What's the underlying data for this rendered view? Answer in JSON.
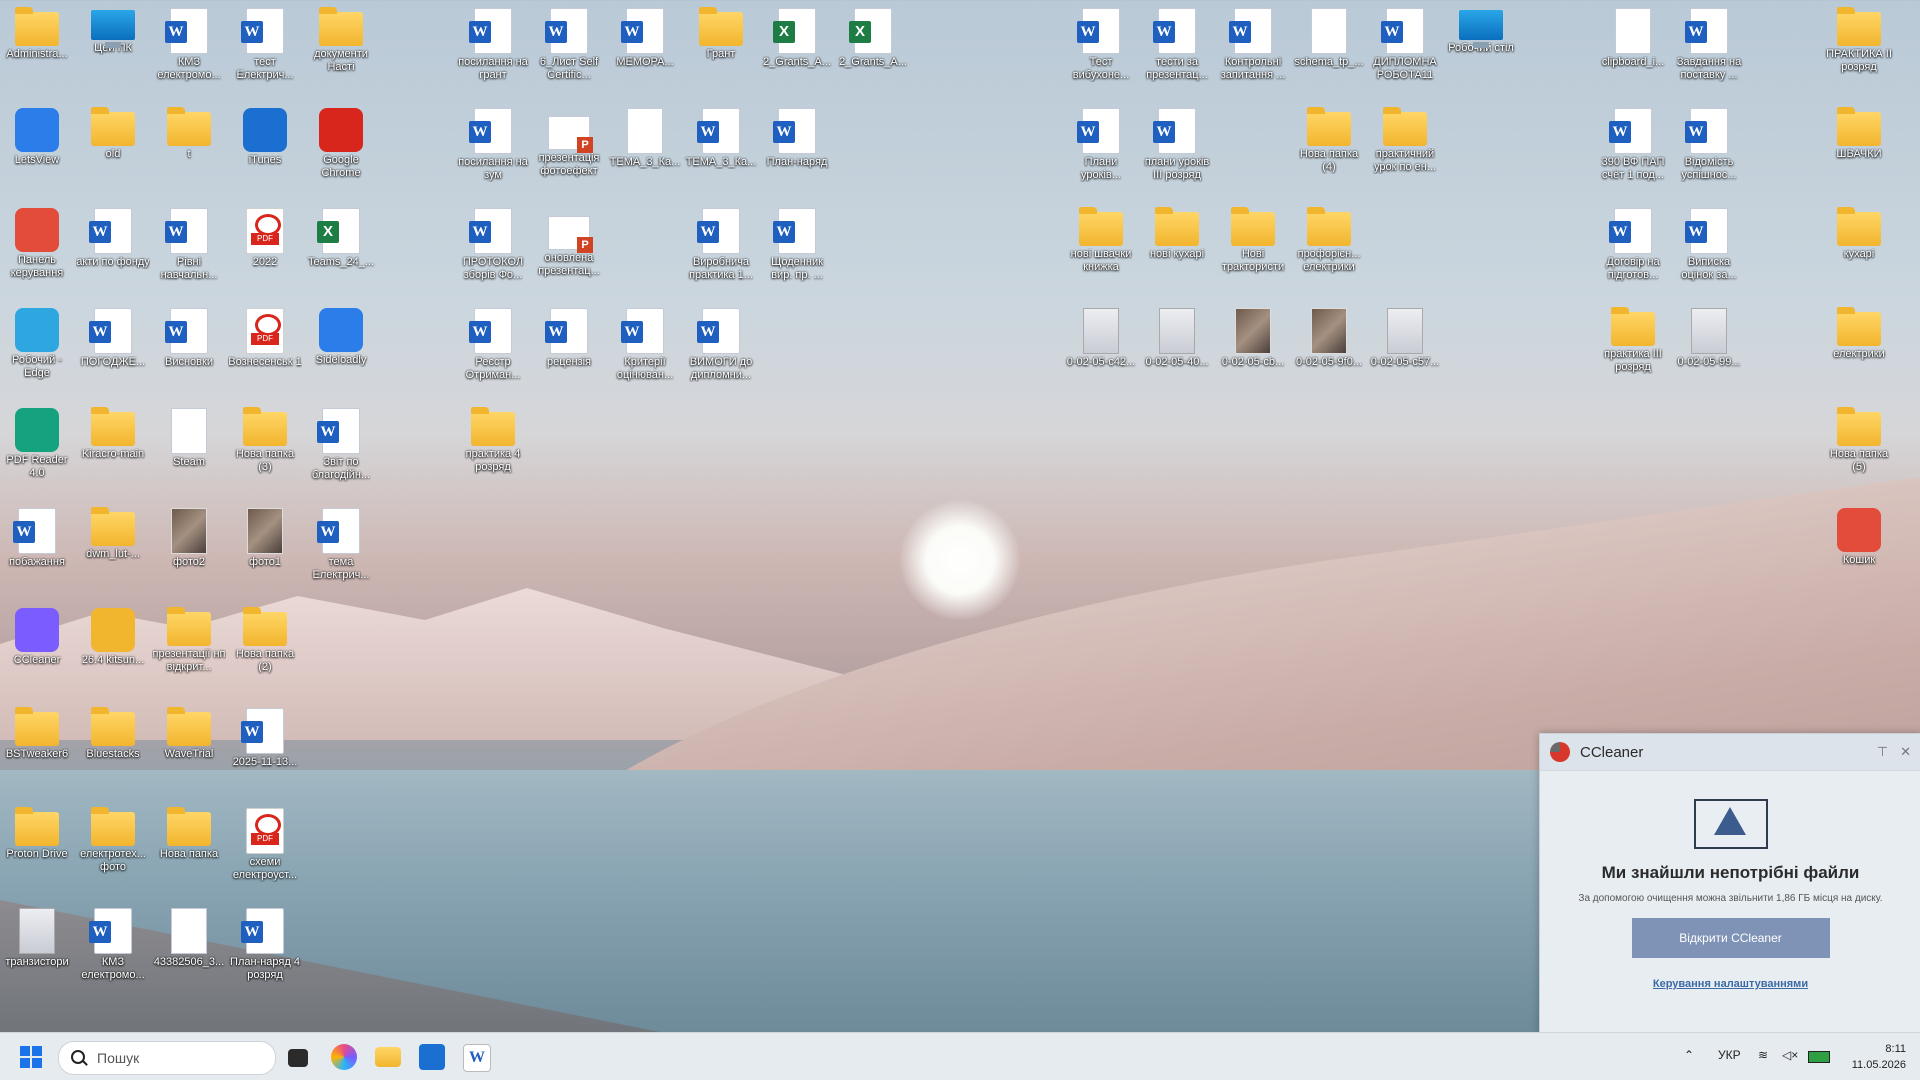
{
  "desktop": {
    "col1": [
      "Administra...",
      "LetsView",
      "Панель керування",
      "Робочий - Edge",
      "PDF Reader 4.0",
      "побажання",
      "CCleaner",
      "BSTweaker6",
      "Proton Drive",
      "транзистори"
    ],
    "col2": [
      "Цей ПК",
      "old",
      "акти по фонду",
      "ПОГОДЖЕ...",
      "Kiracro-main",
      "dwm_lut-...",
      "26.4 kitsun...",
      "Bluestacks",
      "електротех... фото",
      "КМЗ електромо..."
    ],
    "col3": [
      "КМЗ електромо...",
      "t",
      "Рівні навчальн...",
      "Висновки",
      "Steam",
      "фото2",
      "презентації нп відкрит...",
      "WaveTrial",
      "Нова папка",
      "43382506_3..."
    ],
    "col4": [
      "тест Електрич...",
      "iTunes",
      "2022",
      "Вознесенськ 1",
      "Нова папка (3)",
      "фото1",
      "Нова папка (2)",
      "2025-11-13...",
      "схеми електроуст...",
      "План-наряд 4 розряд"
    ],
    "col5": [
      "документи Насті",
      "Google Chrome",
      "Teams_24_...",
      "Sideloadly",
      "Звіт по благодійн...",
      "тема Електрич..."
    ],
    "col7": [
      "посилання на грант",
      "посилання на зум",
      "ПРОТОКОЛ зборів Фо...",
      "Реєстр Отриман...",
      "практика 4 розряд"
    ],
    "col8": [
      "6_Лист Self Certific...",
      "презентація фотоефект",
      "оновлена презентац...",
      "рецензія"
    ],
    "col9": [
      "МЕМОРА...",
      "ТЕМА_3_Ка...",
      "Критерії оцінюван..."
    ],
    "col10": [
      "Грант",
      "ТЕМА_3_Ка...",
      "Виробнича практика 1...",
      "ВИМОГИ до дипломни..."
    ],
    "col11": [
      "2_Grants_A...",
      "План-наряд",
      "Щоденник вир. пр. ..."
    ],
    "col12": [
      "2_Grants_A..."
    ],
    "right1": [
      "Тест вибухоне...",
      "Плани уроків...",
      "нові швачки книжка",
      "0-02-05-c42..."
    ],
    "right2": [
      "тести за презентац...",
      "плани уроків III розряд",
      "нові кухарі",
      "0-02-05-40..."
    ],
    "right3": [
      "Контрольні запитання ...",
      "Нові трактористи",
      "0-02-05-cb..."
    ],
    "right4": [
      "schema_tp_...",
      "Нова папка (4)",
      "профорієн... електрики",
      "0-02-05-9f0..."
    ],
    "right5": [
      "ДИПЛОМНА РОБОТА11",
      "практичний урок по ен...",
      "0-02-05-c57..."
    ],
    "right6": [
      "Робочий стіл"
    ],
    "far1": [
      "clipboard_i...",
      "390 ВФ ПАП счёт 1 под...",
      "Договір на підготов...",
      "практика III розряд"
    ],
    "far2": [
      "Завдання на поставку ...",
      "Відомість успішнос...",
      "Виписка оцінок за...",
      "0-02-05-99..."
    ],
    "far3": [
      "ПРАКТИКА II розряд",
      "ШВАЧКИ",
      "кухарі",
      "електрики",
      "Нова папка (5)",
      "Кошик"
    ]
  },
  "popup": {
    "title": "CCleaner",
    "heading": "Ми знайшли непотрібні файли",
    "subtext": "За допомогою очищення можна звільнити 1,86 ГБ місця на диску.",
    "button": "Відкрити CCleaner",
    "link": "Керування налаштуваннями"
  },
  "taskbar": {
    "search_placeholder": "Пошук",
    "lang": "УКР",
    "time": "8:11",
    "date": "11.05.2026"
  },
  "colors": {
    "accent": "#1a73e8",
    "popup_button": "#7f93b6"
  }
}
